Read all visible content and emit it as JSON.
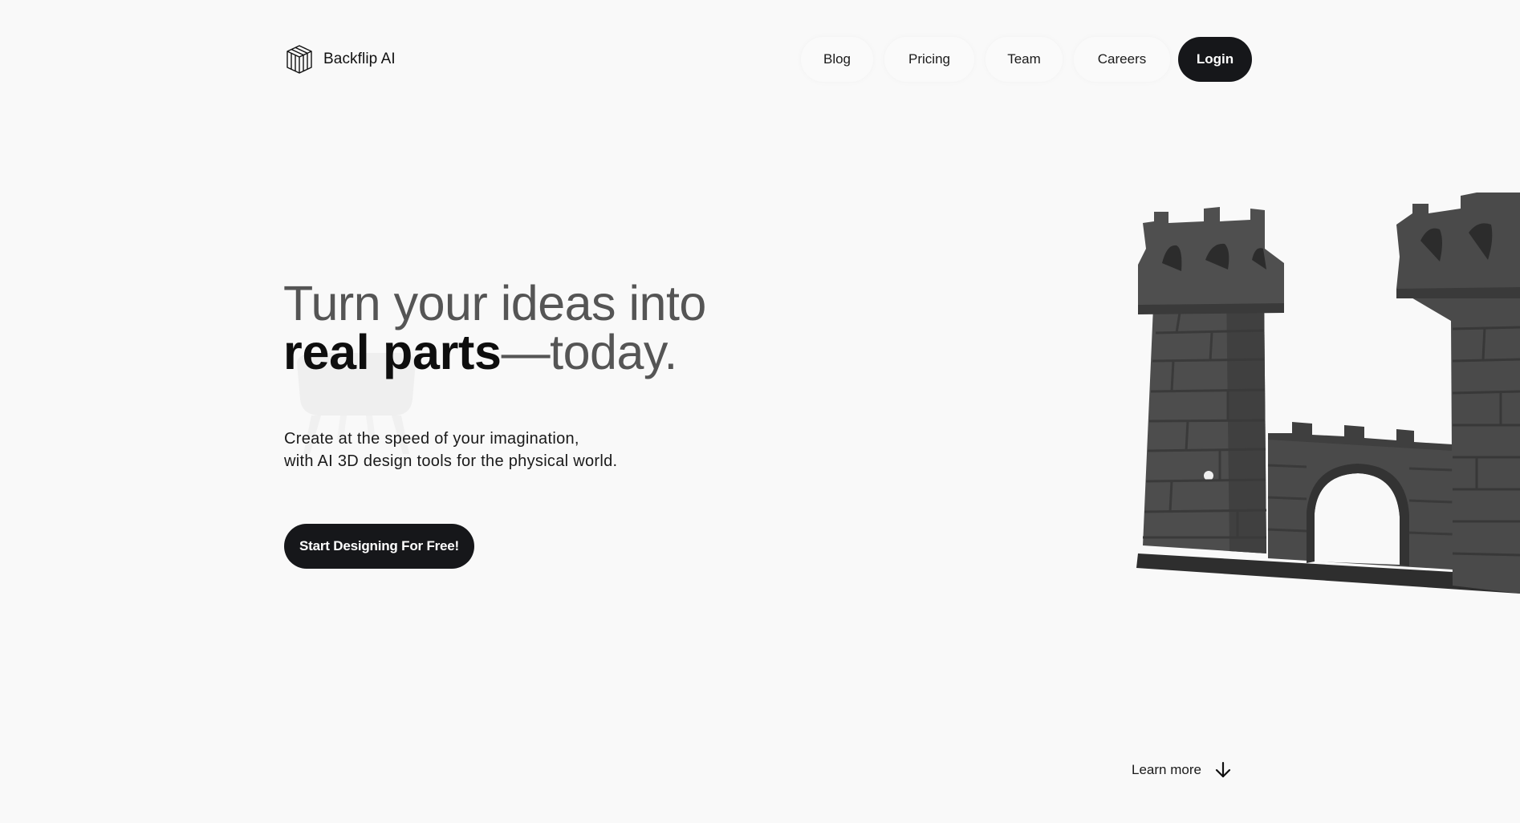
{
  "brand": {
    "name": "Backflip AI",
    "logo_icon": "cube-stack-icon"
  },
  "nav": {
    "items": [
      {
        "label": "Blog"
      },
      {
        "label": "Pricing"
      },
      {
        "label": "Team"
      },
      {
        "label": "Careers"
      }
    ],
    "login_label": "Login"
  },
  "hero": {
    "headline_line1": "Turn your ideas into",
    "headline_line2_bold": "real parts",
    "headline_line2_rest": "—today.",
    "subtitle_line1": "Create at the speed of your imagination,",
    "subtitle_line2": "with AI 3D design tools for the physical world.",
    "cta_label": "Start Designing For Free!",
    "image_icon": "castle-model-icon"
  },
  "footer_hint": {
    "learn_more_label": "Learn more",
    "icon": "arrow-down-icon"
  },
  "colors": {
    "background": "#f9f9f9",
    "dark_button": "#16171a",
    "model_gray": "#4a4a4a"
  }
}
